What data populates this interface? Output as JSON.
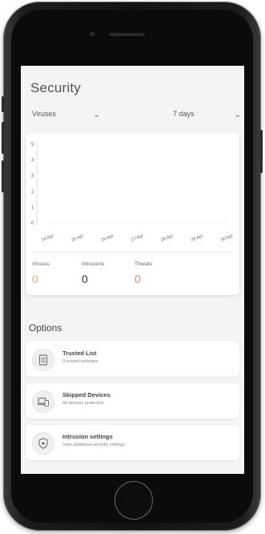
{
  "security": {
    "title": "Security",
    "filter_type": "Viruses",
    "filter_range": "7 days"
  },
  "chart_data": {
    "type": "line",
    "categories": [
      "24 Apr",
      "25 Apr",
      "26 Apr",
      "27 Apr",
      "28 Apr",
      "29 Apr",
      "30 Apr"
    ],
    "y_ticks": [
      "0",
      "1",
      "2",
      "3",
      "4",
      "5"
    ],
    "series": [
      {
        "values": [
          0,
          0,
          0,
          0,
          0,
          0,
          0
        ]
      }
    ],
    "ylim": [
      0,
      5
    ],
    "grid": false
  },
  "stats": {
    "viruses": {
      "label": "Viruses",
      "value": "0",
      "color": "#d7b36a"
    },
    "intrusions": {
      "label": "Intrusions",
      "value": "0",
      "color": "#333333"
    },
    "threats": {
      "label": "Threats",
      "value": "0",
      "color": "#e48a6c"
    }
  },
  "options": {
    "title": "Options",
    "items": [
      {
        "title": "Trusted List",
        "subtitle": "0 trusted websites",
        "icon": "document-list-icon"
      },
      {
        "title": "Skipped Devices",
        "subtitle": "All devices protected",
        "icon": "devices-icon"
      },
      {
        "title": "Intrusion settings",
        "subtitle": "View additional security settings",
        "icon": "shield-icon"
      }
    ]
  }
}
